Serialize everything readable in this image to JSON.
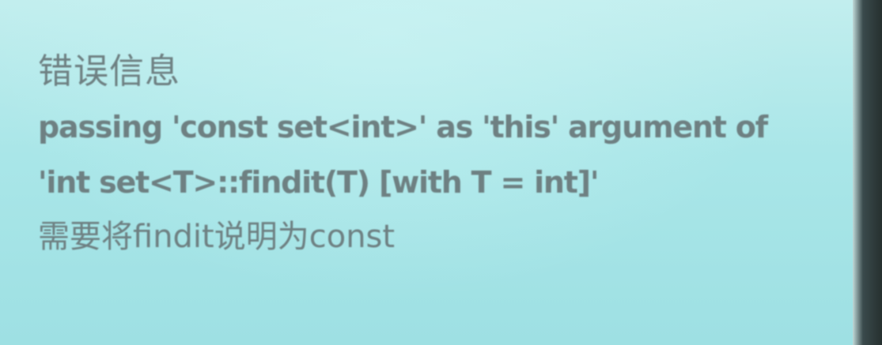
{
  "slide": {
    "title": "错误信息",
    "error_line_1": "passing 'const set<int>' as 'this' argument of",
    "error_line_2": "'int set<T>::findit(T) [with T = int]'",
    "note": "需要将findit说明为const"
  }
}
